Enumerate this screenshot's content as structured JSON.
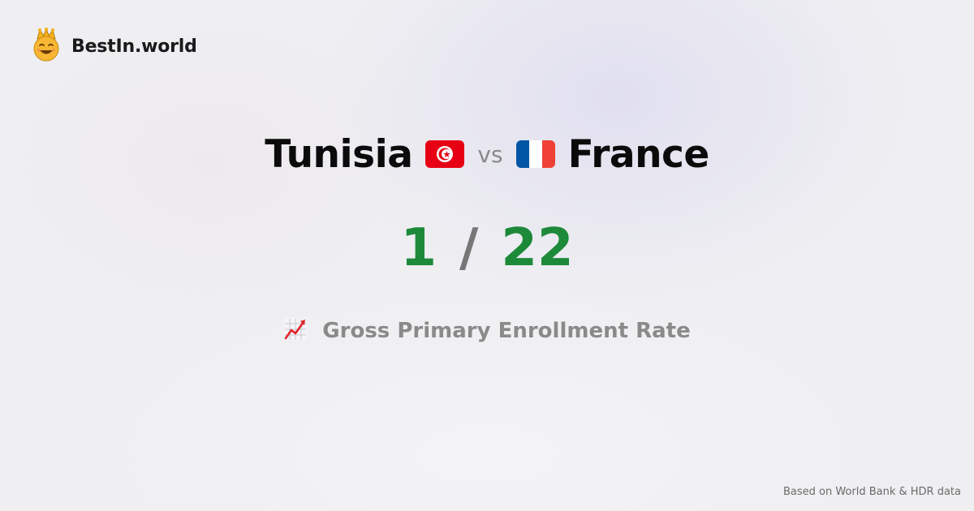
{
  "brand": {
    "name": "BestIn.world",
    "logo_icon": "crown-smiley-icon"
  },
  "comparison": {
    "left_country": "Tunisia",
    "left_flag": "tunisia-flag-icon",
    "vs_label": "vs",
    "right_country": "France",
    "right_flag": "france-flag-icon",
    "left_rank": "1",
    "separator": "/",
    "right_rank": "22"
  },
  "metric": {
    "label": "Gross Primary Enrollment Rate",
    "icon": "chart-increasing-icon"
  },
  "footer": {
    "source": "Based on World Bank & HDR data"
  },
  "colors": {
    "rank_green": "#1d8a3a",
    "muted_gray": "#8a8a8a",
    "tunisia_red": "#e70013",
    "france_blue": "#0055a4",
    "france_red": "#ef4135"
  }
}
